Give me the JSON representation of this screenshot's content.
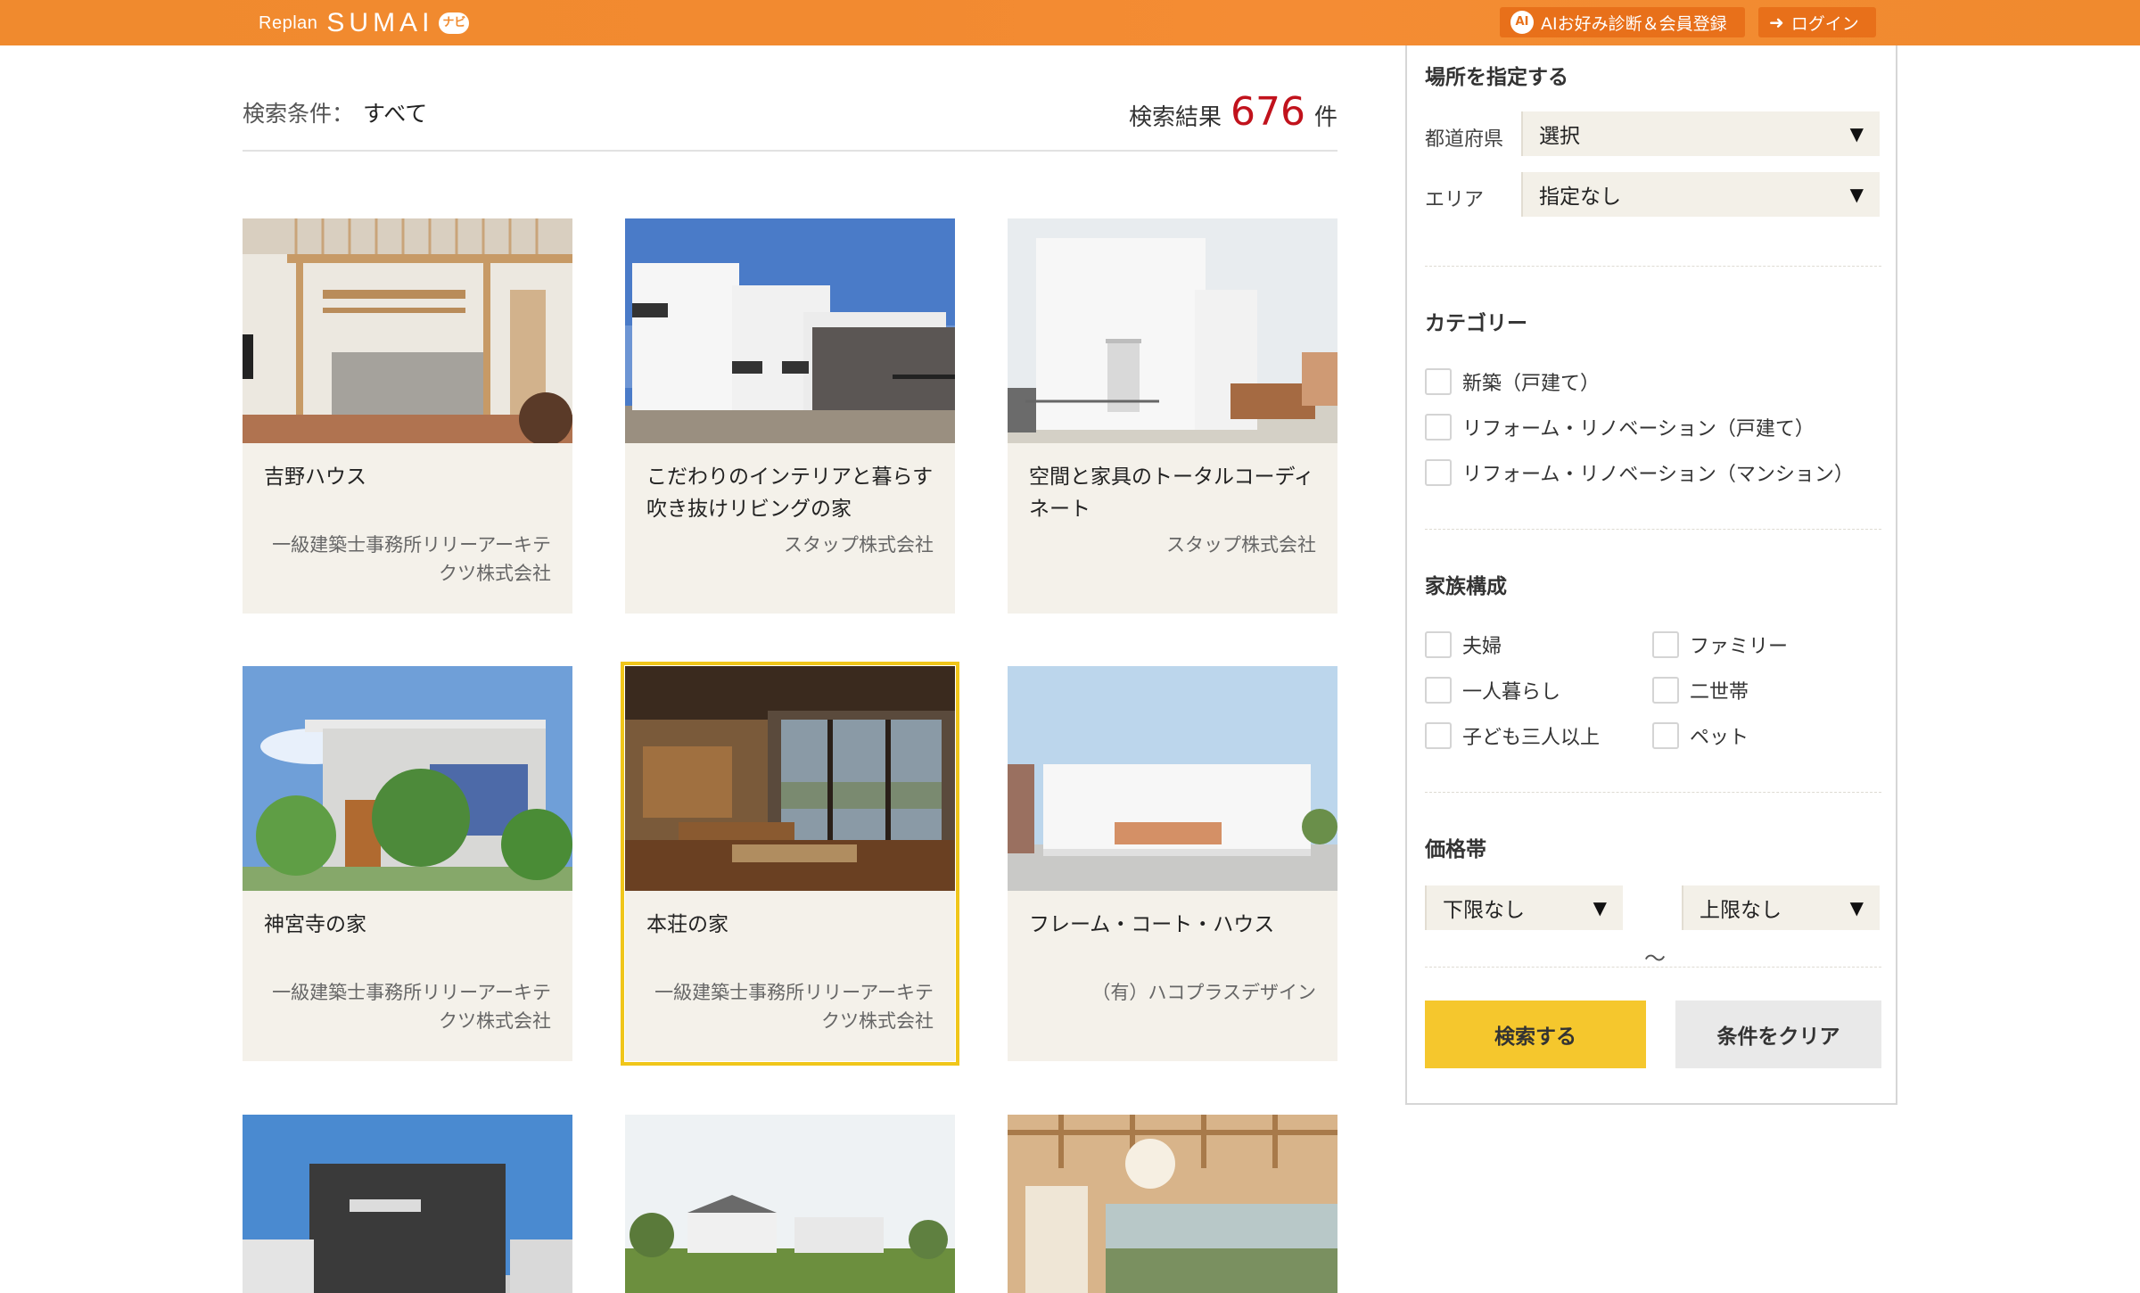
{
  "header": {
    "logo_replan": "Replan",
    "logo_sumai": "SUMAI",
    "logo_navi": "ナビ",
    "ai_button": "AIお好み診断＆会員登録",
    "login_button": "ログイン"
  },
  "summary": {
    "condition_label": "検索条件：",
    "condition_value": "すべて",
    "result_label": "検索結果",
    "result_count": "676",
    "result_unit": "件"
  },
  "cards": [
    {
      "title": "吉野ハウス",
      "company": "一級建築士事務所リリーアーキテクツ株式会社"
    },
    {
      "title": "こだわりのインテリアと暮らす 吹き抜けリビングの家",
      "company": "スタップ株式会社"
    },
    {
      "title": "空間と家具のトータルコーディネート",
      "company": "スタップ株式会社"
    },
    {
      "title": "神宮寺の家",
      "company": "一級建築士事務所リリーアーキテクツ株式会社"
    },
    {
      "title": "本荘の家",
      "company": "一級建築士事務所リリーアーキテクツ株式会社"
    },
    {
      "title": "フレーム・コート・ハウス",
      "company": "（有）ハコプラスデザイン"
    }
  ],
  "sidebar": {
    "location_heading": "場所を指定する",
    "prefecture_label": "都道府県",
    "prefecture_value": "選択",
    "area_label": "エリア",
    "area_value": "指定なし",
    "category_heading": "カテゴリー",
    "categories": [
      "新築（戸建て）",
      "リフォーム・リノベーション（戸建て）",
      "リフォーム・リノベーション（マンション）"
    ],
    "family_heading": "家族構成",
    "family": [
      "夫婦",
      "ファミリー",
      "一人暮らし",
      "二世帯",
      "子ども三人以上",
      "ペット"
    ],
    "price_heading": "価格帯",
    "price_min": "下限なし",
    "price_separator": "～",
    "price_max": "上限なし",
    "search_button": "検索する",
    "clear_button": "条件をクリア"
  }
}
